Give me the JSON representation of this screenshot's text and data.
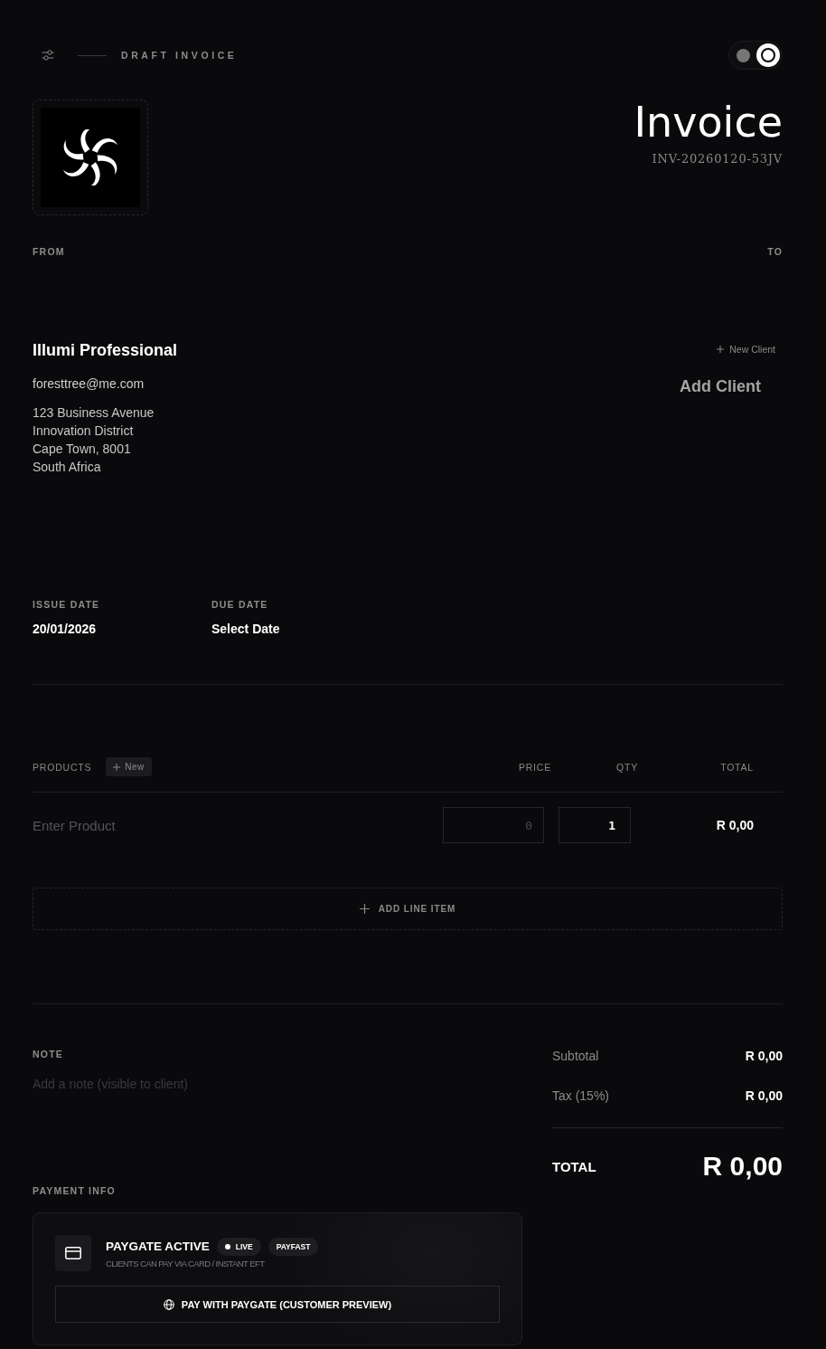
{
  "header": {
    "label": "DRAFT INVOICE",
    "theme_toggle": {
      "on": true
    }
  },
  "invoice": {
    "title": "Invoice",
    "number": "INV-20260120-53JV"
  },
  "from": {
    "label": "FROM",
    "name": "Illumi Professional",
    "email": "foresttree@me.com",
    "address": [
      "123 Business Avenue",
      "Innovation District",
      "Cape Town, 8001",
      "South Africa"
    ]
  },
  "to": {
    "label": "TO",
    "new_client": "New Client",
    "add_client": "Add Client"
  },
  "dates": [
    {
      "label": "ISSUE DATE",
      "value": "20/01/2026"
    },
    {
      "label": "DUE DATE",
      "value": "Select Date"
    }
  ],
  "products": {
    "label": "PRODUCTS",
    "new_button": "New",
    "columns": [
      "PRICE",
      "QTY",
      "TOTAL"
    ],
    "rows": [
      {
        "product_placeholder": "Enter Product",
        "price_placeholder": "0",
        "qty": "1",
        "total": "R 0,00"
      }
    ],
    "add_line": "ADD LINE ITEM"
  },
  "note": {
    "label": "NOTE",
    "placeholder": "Add a note (visible to client)"
  },
  "totals": {
    "rows": [
      {
        "label": "Subtotal",
        "value": "R 0,00"
      },
      {
        "label": "Tax (15%)",
        "value": "R 0,00"
      }
    ],
    "total_label": "TOTAL",
    "total_value": "R 0,00"
  },
  "payment": {
    "label": "PAYMENT INFO",
    "title": "PAYGATE ACTIVE",
    "badges": [
      {
        "kind": "status",
        "text": "LIVE"
      },
      {
        "kind": "plain",
        "text": "PAYFAST"
      }
    ],
    "subtitle": "CLIENTS CAN PAY VIA CARD / INSTANT EFT",
    "button": "PAY WITH PAYGATE (CUSTOMER PREVIEW)"
  }
}
